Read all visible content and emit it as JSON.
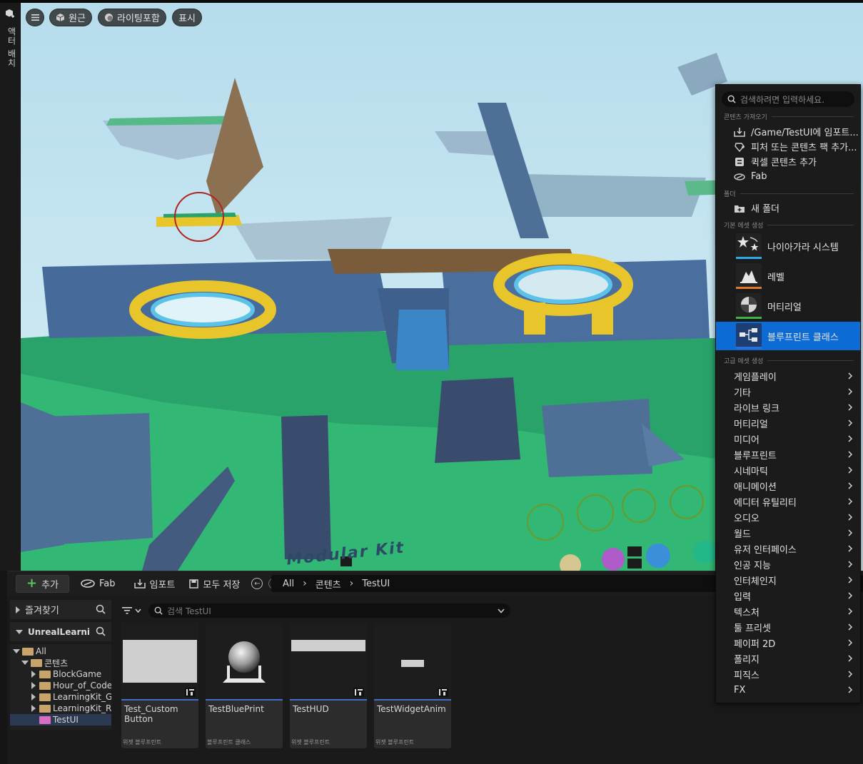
{
  "left_rail": {
    "label": "액터 배치",
    "icon": "place-actor-icon"
  },
  "viewport": {
    "menu_icon": "hamburger-icon",
    "perspective_label": "원근",
    "lighting_label": "라이팅포함",
    "show_label": "표시",
    "watermark_text": "Modular Kit"
  },
  "toolbar": {
    "add_label": "추가",
    "fab_label": "Fab",
    "import_label": "임포트",
    "save_all_label": "모두 저장"
  },
  "breadcrumb": {
    "items": [
      "All",
      "콘텐츠",
      "TestUI"
    ]
  },
  "sidebar": {
    "favorites_label": "즐겨찾기",
    "project_label": "UnrealLearning",
    "tree": [
      {
        "label": "All",
        "level": 0,
        "color": "yellow",
        "selected": false
      },
      {
        "label": "콘텐츠",
        "level": 1,
        "color": "yellow",
        "selected": false
      },
      {
        "label": "BlockGame",
        "level": 2,
        "color": "yellow",
        "selected": false
      },
      {
        "label": "Hour_of_Code",
        "level": 2,
        "color": "yellow",
        "selected": false
      },
      {
        "label": "LearningKit_Ga",
        "level": 2,
        "color": "yellow",
        "selected": false
      },
      {
        "label": "LearningKit_Ro",
        "level": 2,
        "color": "yellow",
        "selected": false
      },
      {
        "label": "TestUI",
        "level": 2,
        "color": "pink",
        "selected": true
      }
    ]
  },
  "search": {
    "placeholder": "검색 TestUI"
  },
  "assets": [
    {
      "name": "Test_Custom Button",
      "type": "위젯 블루프린트",
      "thumb": "widget-button"
    },
    {
      "name": "TestBluePrint",
      "type": "블루프린트 클래스",
      "thumb": "sphere"
    },
    {
      "name": "TestHUD",
      "type": "위젯 블루프린트",
      "thumb": "widget-hud"
    },
    {
      "name": "TestWidgetAnim",
      "type": "위젯 블루프린트",
      "thumb": "widget-anim"
    }
  ],
  "add_menu": {
    "search_placeholder": "검색하려면 입력하세요.",
    "sections": {
      "import": "콘텐츠 가져오기",
      "folder": "폴더",
      "basic": "기본 에셋 생성",
      "advanced": "고급 에셋 생성"
    },
    "import_items": [
      {
        "label": "/Game/TestUI에 임포트...",
        "icon": "import-icon"
      },
      {
        "label": "피처 또는 콘텐츠 팩 추가...",
        "icon": "feature-pack-icon"
      },
      {
        "label": "퀵셀 콘텐츠 추가",
        "icon": "quixel-icon"
      },
      {
        "label": "Fab",
        "icon": "fab-icon"
      }
    ],
    "folder_item": {
      "label": "새 폴더",
      "icon": "new-folder-icon"
    },
    "basic_items": [
      {
        "label": "나이아가라 시스템",
        "icon": "niagara-icon",
        "accent": "#2fa8e6"
      },
      {
        "label": "레벨",
        "icon": "level-icon",
        "accent": "#e07a2a"
      },
      {
        "label": "머티리얼",
        "icon": "material-icon",
        "accent": "#3cb44a"
      },
      {
        "label": "블루프린트 클래스",
        "icon": "blueprint-class-icon",
        "accent": "#2d6fd6"
      }
    ],
    "selected_basic": "블루프린트 클래스",
    "advanced_items": [
      "게임플레이",
      "기타",
      "라이브 링크",
      "머티리얼",
      "미디어",
      "블루프린트",
      "시네마틱",
      "애니메이션",
      "에디터 유틸리티",
      "오디오",
      "월드",
      "유저 인터페이스",
      "인공 지능",
      "인터체인지",
      "입력",
      "텍스처",
      "툴 프리셋",
      "페이퍼 2D",
      "폴리지",
      "피직스",
      "FX"
    ]
  }
}
